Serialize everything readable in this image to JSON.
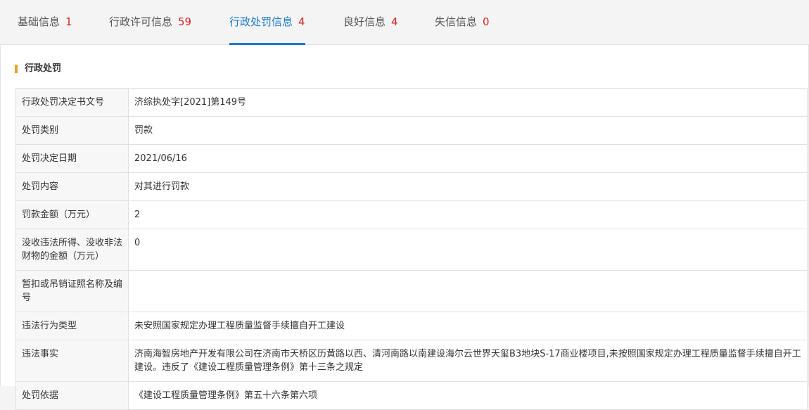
{
  "tabs": [
    {
      "label": "基础信息",
      "count": "1"
    },
    {
      "label": "行政许可信息",
      "count": "59"
    },
    {
      "label": "行政处罚信息",
      "count": "4"
    },
    {
      "label": "良好信息",
      "count": "4"
    },
    {
      "label": "失信信息",
      "count": "0"
    }
  ],
  "section": {
    "title": "行政处罚"
  },
  "rows": [
    {
      "label": "行政处罚决定书文号",
      "value": "济综执处字[2021]第149号"
    },
    {
      "label": "处罚类别",
      "value": "罚款"
    },
    {
      "label": "处罚决定日期",
      "value": "2021/06/16"
    },
    {
      "label": "处罚内容",
      "value": "对其进行罚款"
    },
    {
      "label": "罚款金额（万元）",
      "value": "2"
    },
    {
      "label": "没收违法所得、没收非法财物的金额（万元）",
      "value": "0"
    },
    {
      "label": "暂扣或吊销证照名称及编号",
      "value": ""
    },
    {
      "label": "违法行为类型",
      "value": "未安照国家规定办理工程质量监督手续擅自开工建设"
    },
    {
      "label": "违法事实",
      "value": "济南海智房地产开发有限公司在济南市天桥区历黄路以西、清河南路以南建设海尔云世界天玺B3地块S-17商业楼项目,未按照国家规定办理工程质量监督手续擅自开工建设。违反了《建设工程质量管理条例》第十三条之规定"
    },
    {
      "label": "处罚依据",
      "value": "《建设工程质量管理条例》第五十六条第六项"
    }
  ],
  "colors": {
    "accent": "#1a7ad1",
    "count": "#e02020",
    "section_marker": "#f0a020"
  }
}
